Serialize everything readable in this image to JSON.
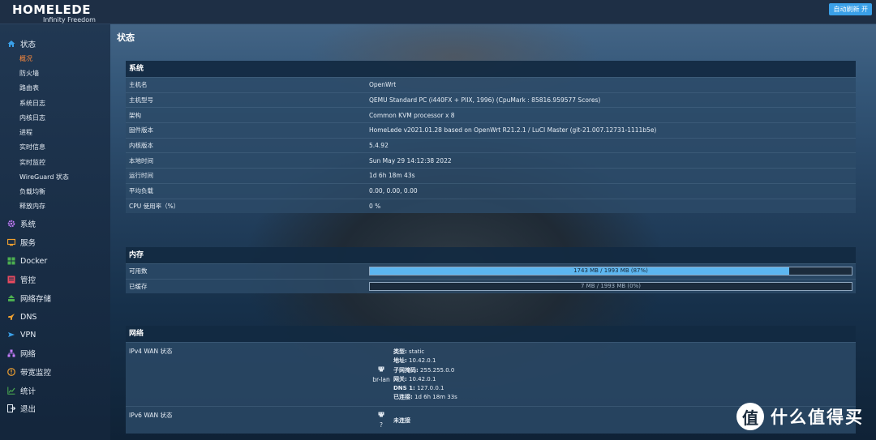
{
  "header": {
    "logo_main": "HOMELEDE",
    "logo_sub": "Infinity Freedom",
    "auto_refresh": "自动刷新 开"
  },
  "sidebar": {
    "top_items": [
      {
        "label": "状态",
        "icon": "home-icon",
        "color": "#3aa0e8"
      },
      {
        "label": "系统",
        "icon": "gear-icon",
        "color": "#c77dff"
      },
      {
        "label": "服务",
        "icon": "service-icon",
        "color": "#f0a030"
      },
      {
        "label": "Docker",
        "icon": "docker-icon",
        "color": "#4caf50"
      },
      {
        "label": "管控",
        "icon": "control-icon",
        "color": "#e84a5f"
      },
      {
        "label": "网络存储",
        "icon": "storage-icon",
        "color": "#4caf50"
      },
      {
        "label": "DNS",
        "icon": "rocket-icon",
        "color": "#f0a030"
      },
      {
        "label": "VPN",
        "icon": "plane-icon",
        "color": "#3aa0e8"
      },
      {
        "label": "网络",
        "icon": "network-icon",
        "color": "#c77dff"
      },
      {
        "label": "带宽监控",
        "icon": "bandwidth-icon",
        "color": "#f0a030"
      },
      {
        "label": "统计",
        "icon": "chart-icon",
        "color": "#4caf50"
      },
      {
        "label": "退出",
        "icon": "logout-icon",
        "color": "#e6edf5"
      }
    ],
    "sub_items": [
      {
        "label": "概况",
        "active": true
      },
      {
        "label": "防火墙",
        "active": false
      },
      {
        "label": "路由表",
        "active": false
      },
      {
        "label": "系统日志",
        "active": false
      },
      {
        "label": "内核日志",
        "active": false
      },
      {
        "label": "进程",
        "active": false
      },
      {
        "label": "实时信息",
        "active": false
      },
      {
        "label": "实时监控",
        "active": false
      },
      {
        "label": "WireGuard 状态",
        "active": false
      },
      {
        "label": "负载均衡",
        "active": false
      },
      {
        "label": "释放内存",
        "active": false
      }
    ]
  },
  "page_title": "状态",
  "system": {
    "title": "系统",
    "rows": [
      {
        "key": "主机名",
        "value": "OpenWrt"
      },
      {
        "key": "主机型号",
        "value": "QEMU Standard PC (i440FX + PIIX, 1996) (CpuMark : 85816.959577 Scores)"
      },
      {
        "key": "架构",
        "value": "Common KVM processor x 8"
      },
      {
        "key": "固件版本",
        "value": "HomeLede v2021.01.28 based on OpenWrt R21.2.1 / LuCI Master (git-21.007.12731-1111b5e)"
      },
      {
        "key": "内核版本",
        "value": "5.4.92"
      },
      {
        "key": "本地时间",
        "value": "Sun May 29 14:12:38 2022"
      },
      {
        "key": "运行时间",
        "value": "1d 6h 18m 43s"
      },
      {
        "key": "平均负载",
        "value": "0.00, 0.00, 0.00"
      },
      {
        "key": "CPU 使用率（%）",
        "value": "0 %"
      }
    ]
  },
  "memory": {
    "title": "内存",
    "rows": [
      {
        "key": "可用数",
        "text": "1743 MB / 1993 MB (87%)",
        "fraction": 0.87
      },
      {
        "key": "已缓存",
        "text": "7 MB / 1993 MB (0%)",
        "fraction": 0.0
      }
    ]
  },
  "network": {
    "title": "网络",
    "ipv4": {
      "key": "IPv4 WAN 状态",
      "iface": "br-lan",
      "details": [
        {
          "label": "类型:",
          "value": "static"
        },
        {
          "label": "地址:",
          "value": "10.42.0.1"
        },
        {
          "label": "子网掩码:",
          "value": "255.255.0.0"
        },
        {
          "label": "网关:",
          "value": "10.42.0.1"
        },
        {
          "label": "DNS 1:",
          "value": "127.0.0.1"
        },
        {
          "label": "已连接:",
          "value": "1d 6h 18m 33s"
        }
      ]
    },
    "ipv6": {
      "key": "IPv6 WAN 状态",
      "iface": "?",
      "status": "未连接"
    }
  },
  "watermark": {
    "symbol": "值",
    "text": "什么值得买"
  }
}
